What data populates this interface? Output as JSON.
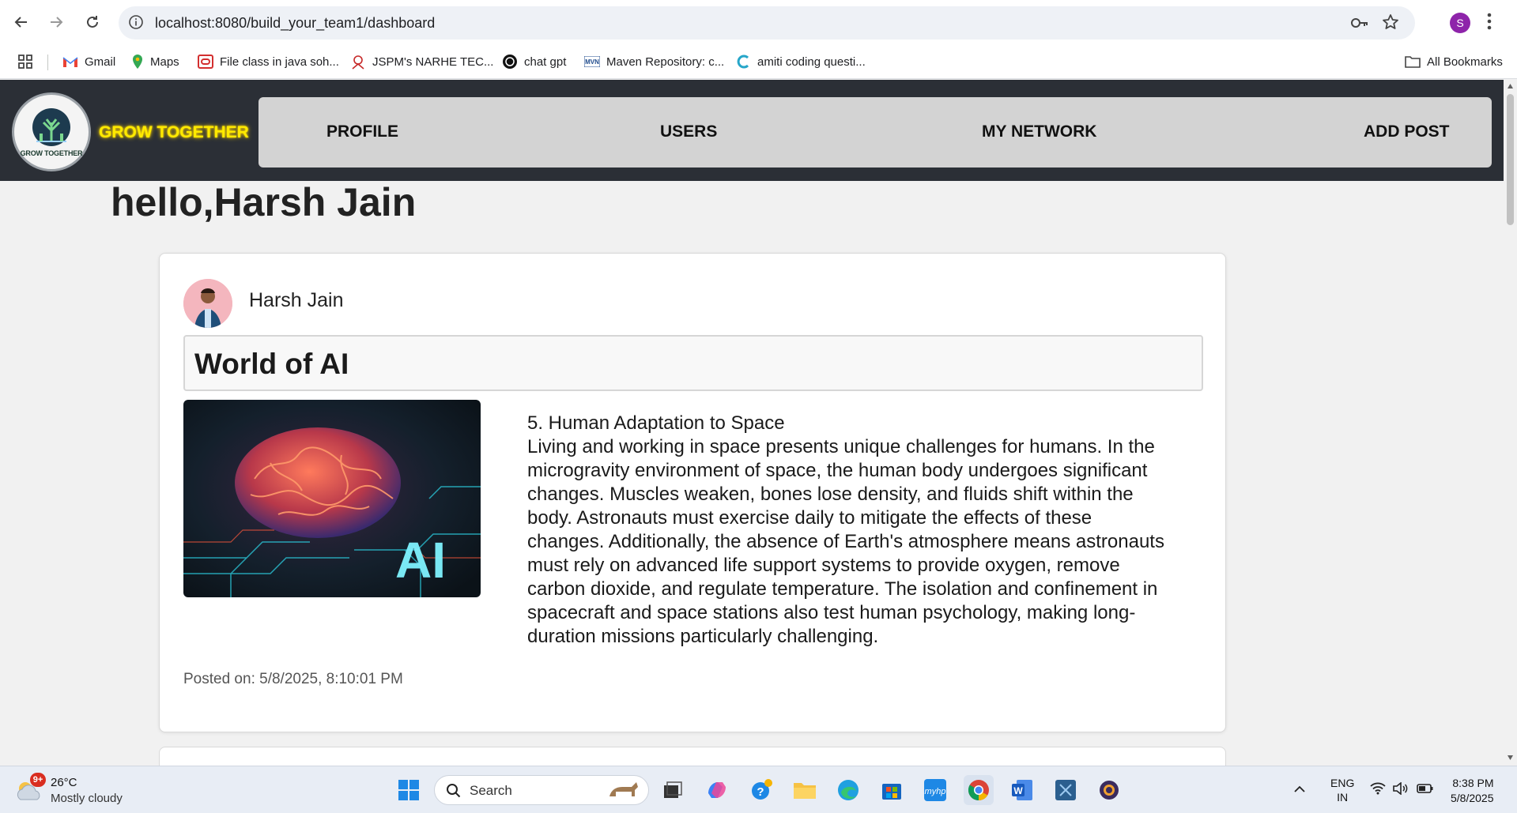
{
  "browser": {
    "url": "localhost:8080/build_your_team1/dashboard",
    "profile_initial": "S",
    "bookmarks": [
      "Gmail",
      "Maps",
      "File class in java soh...",
      "JSPM's NARHE TEC...",
      "chat gpt",
      "Maven Repository: c...",
      "amiti coding questi..."
    ],
    "all_bookmarks": "All Bookmarks"
  },
  "app": {
    "brand": "GROW TOGETHER",
    "logo_text": "GROW TOGETHER",
    "nav": [
      "PROFILE",
      "USERS",
      "MY NETWORK",
      "ADD POST"
    ],
    "greeting": "hello,Harsh Jain"
  },
  "post": {
    "author": "Harsh Jain",
    "title": "World of AI",
    "image_label": "AI",
    "body_lines": [
      "5. Human Adaptation to Space",
      "Living and working in space presents unique challenges for humans. In the",
      "microgravity environment of space, the human body undergoes significant",
      "changes. Muscles weaken, bones lose density, and fluids shift within the",
      "body. Astronauts must exercise daily to mitigate the effects of these",
      "changes. Additionally, the absence of Earth's atmosphere means astronauts",
      "must rely on advanced life support systems to provide oxygen, remove",
      "carbon dioxide, and regulate temperature. The isolation and confinement in",
      "spacecraft and space stations also test human psychology, making long-",
      "duration missions particularly challenging."
    ],
    "posted_on": "Posted on: 5/8/2025, 8:10:01 PM"
  },
  "taskbar": {
    "weather_badge": "9+",
    "temperature": "26°C",
    "condition": "Mostly cloudy",
    "search_placeholder": "Search",
    "lang_1": "ENG",
    "lang_2": "IN",
    "time": "8:38 PM",
    "date": "5/8/2025"
  },
  "colors": {
    "header_bg": "#2b2f36",
    "nav_bg": "#d3d3d3",
    "brand": "#ffea00",
    "page_bg": "#f1f1f1"
  }
}
